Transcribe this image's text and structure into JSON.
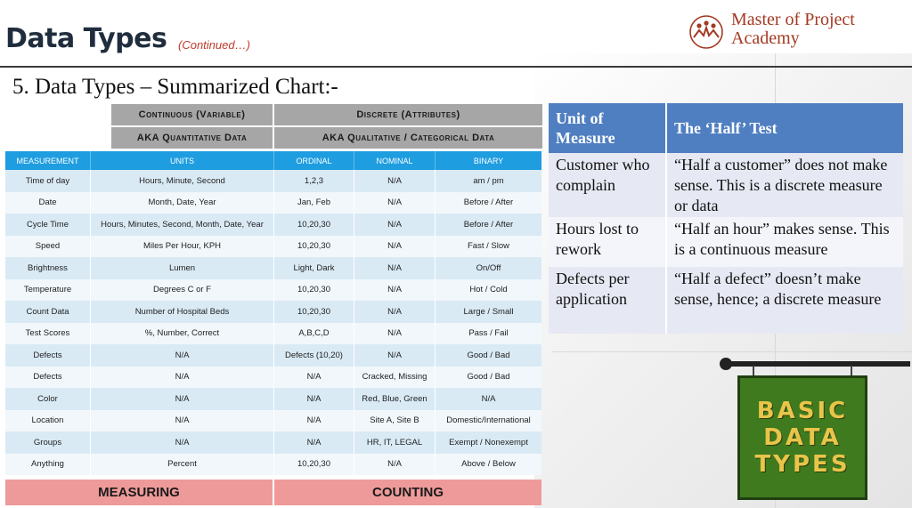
{
  "header": {
    "title": "Data Types",
    "subtitle": "(Continued…)",
    "logo_line1": "Master of Project",
    "logo_line2": "Academy"
  },
  "section_title": "5.   Data Types – Summarized Chart:-",
  "left_table": {
    "category_row1": [
      "Continuous (Variable)",
      "Discrete (Attributes)"
    ],
    "category_row2": [
      "AKA Quantitative Data",
      "AKA Qualitative / Categorical Data"
    ],
    "columns": [
      "MEASUREMENT",
      "UNITS",
      "ORDINAL",
      "NOMINAL",
      "BINARY"
    ],
    "rows": [
      [
        "Time of day",
        "Hours, Minute, Second",
        "1,2,3",
        "N/A",
        "am / pm"
      ],
      [
        "Date",
        "Month, Date, Year",
        "Jan, Feb",
        "N/A",
        "Before / After"
      ],
      [
        "Cycle Time",
        "Hours, Minutes, Second, Month, Date, Year",
        "10,20,30",
        "N/A",
        "Before / After"
      ],
      [
        "Speed",
        "Miles Per Hour, KPH",
        "10,20,30",
        "N/A",
        "Fast / Slow"
      ],
      [
        "Brightness",
        "Lumen",
        "Light, Dark",
        "N/A",
        "On/Off"
      ],
      [
        "Temperature",
        "Degrees C or F",
        "10,20,30",
        "N/A",
        "Hot / Cold"
      ],
      [
        "Count Data",
        "Number of Hospital Beds",
        "10,20,30",
        "N/A",
        "Large / Small"
      ],
      [
        "Test Scores",
        "%, Number, Correct",
        "A,B,C,D",
        "N/A",
        "Pass / Fail"
      ],
      [
        "Defects",
        "N/A",
        "Defects (10,20)",
        "N/A",
        "Good / Bad"
      ],
      [
        "Defects",
        "N/A",
        "N/A",
        "Cracked, Missing",
        "Good / Bad"
      ],
      [
        "Color",
        "N/A",
        "N/A",
        "Red, Blue, Green",
        "N/A"
      ],
      [
        "Location",
        "N/A",
        "N/A",
        "Site A, Site B",
        "Domestic/International"
      ],
      [
        "Groups",
        "N/A",
        "N/A",
        "HR, IT, LEGAL",
        "Exempt / Nonexempt"
      ],
      [
        "Anything",
        "Percent",
        "10,20,30",
        "N/A",
        "Above / Below"
      ]
    ],
    "footer": [
      "MEASURING",
      "COUNTING"
    ]
  },
  "right_table": {
    "headers": [
      "Unit of Measure",
      "The ‘Half’ Test"
    ],
    "rows": [
      [
        "Customer who complain",
        "“Half a customer” does not make sense. This is a discrete measure or data"
      ],
      [
        "Hours lost to rework",
        "“Half an hour” makes sense. This is a continuous measure"
      ],
      [
        "Defects per application",
        "“Half a defect” doesn’t make sense, hence; a discrete measure"
      ]
    ]
  },
  "sign": {
    "lines": [
      "BASIC",
      "DATA",
      "TYPES"
    ]
  },
  "colors": {
    "header_blue": "#1e9de0",
    "row_light_blue": "#d9eaf5",
    "category_gray": "#a6a6a6",
    "footer_pink": "#ef9a9a",
    "right_header_blue": "#4f7fc1",
    "sign_green": "#3f7a1f",
    "sign_text_gold": "#e8c54a",
    "logo_red": "#a33a22"
  }
}
